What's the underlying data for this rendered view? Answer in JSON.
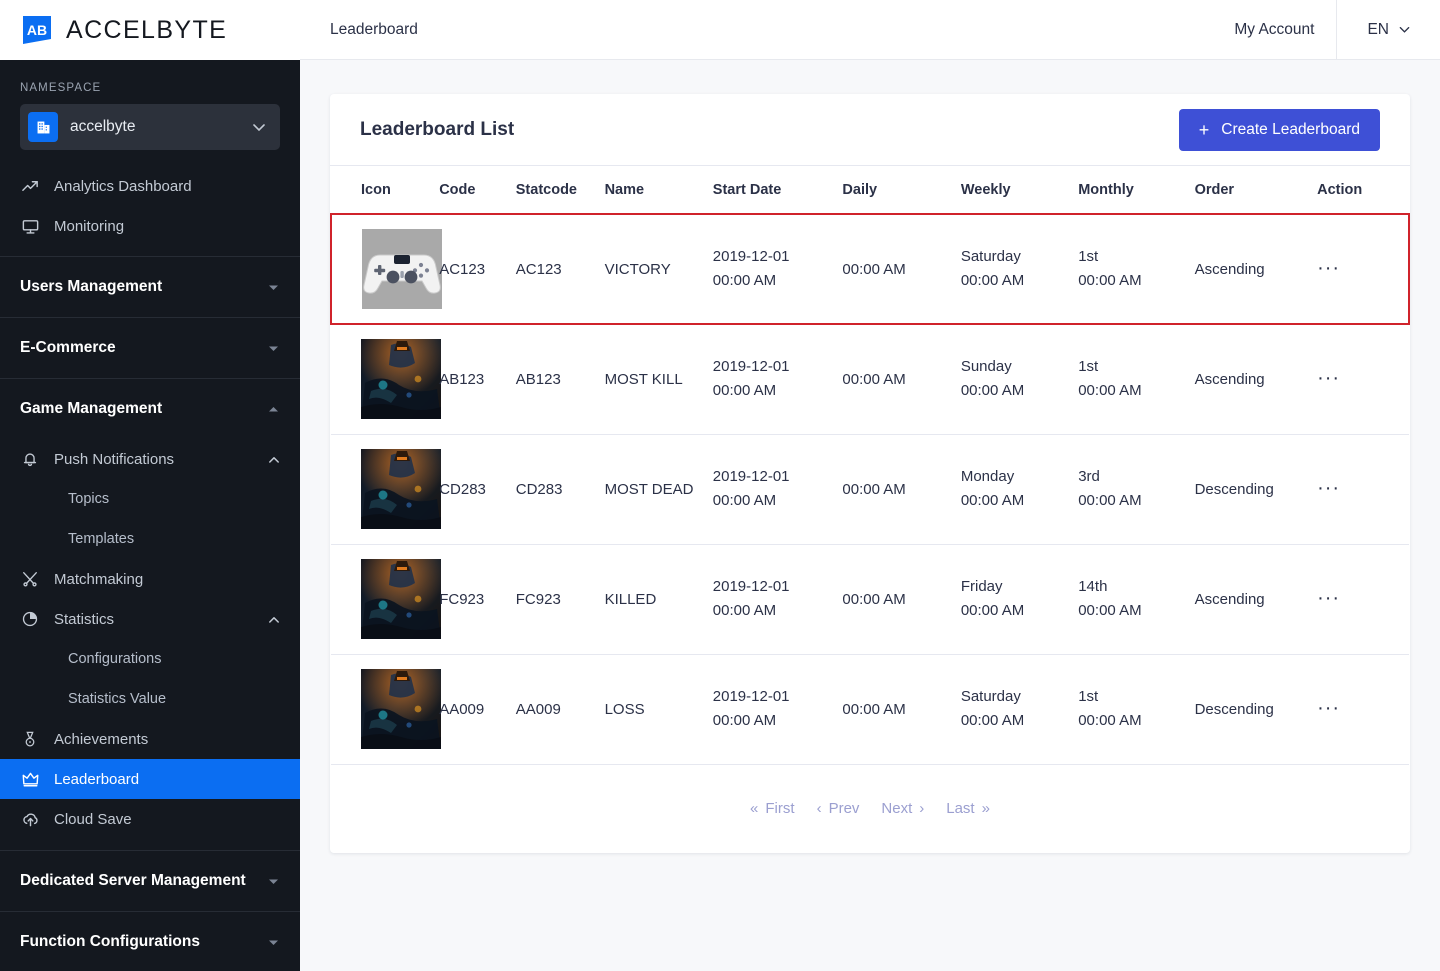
{
  "brand": {
    "name": "ACCELBYTE",
    "logo_icon": "accelbyte-logo-icon"
  },
  "sidebar": {
    "namespace_label": "NAMESPACE",
    "namespace_value": "accelbyte",
    "namespace_icon": "building-icon",
    "items": [
      {
        "label": "Analytics Dashboard",
        "icon": "trend-up-icon",
        "type": "item"
      },
      {
        "label": "Monitoring",
        "icon": "monitor-icon",
        "type": "item"
      },
      {
        "label": "Users Management",
        "icon": "",
        "type": "group",
        "caret": "down"
      },
      {
        "label": "E-Commerce",
        "icon": "",
        "type": "group",
        "caret": "down"
      },
      {
        "label": "Game Management",
        "icon": "",
        "type": "group",
        "caret": "up"
      },
      {
        "label": "Push Notifications",
        "icon": "bell-icon",
        "type": "item",
        "caret": "up"
      },
      {
        "label": "Topics",
        "icon": "",
        "type": "sub"
      },
      {
        "label": "Templates",
        "icon": "",
        "type": "sub"
      },
      {
        "label": "Matchmaking",
        "icon": "matchmaking-icon",
        "type": "item"
      },
      {
        "label": "Statistics",
        "icon": "pie-chart-icon",
        "type": "item",
        "caret": "up"
      },
      {
        "label": "Configurations",
        "icon": "",
        "type": "sub"
      },
      {
        "label": "Statistics Value",
        "icon": "",
        "type": "sub"
      },
      {
        "label": "Achievements",
        "icon": "medal-icon",
        "type": "item"
      },
      {
        "label": "Leaderboard",
        "icon": "crown-icon",
        "type": "item",
        "active": true
      },
      {
        "label": "Cloud Save",
        "icon": "cloud-upload-icon",
        "type": "item"
      },
      {
        "label": "Dedicated Server Management",
        "icon": "",
        "type": "group",
        "caret": "down"
      },
      {
        "label": "Function Configurations",
        "icon": "",
        "type": "group",
        "caret": "down"
      }
    ],
    "active_color": "#0B6EF2"
  },
  "topbar": {
    "breadcrumb": "Leaderboard",
    "my_account": "My Account",
    "language": "EN"
  },
  "card": {
    "title": "Leaderboard List",
    "create_button": "Create Leaderboard",
    "create_button_color": "#3E50D6",
    "columns": [
      "Icon",
      "Code",
      "Statcode",
      "Name",
      "Start Date",
      "Daily",
      "Weekly",
      "Monthly",
      "Order",
      "Action"
    ],
    "rows": [
      {
        "icon": "ps4-controller-thumbnail",
        "icon_kind": "controller",
        "code": "AC123",
        "statcode": "AC123",
        "name": "VICTORY",
        "start_date": "2019-12-01",
        "start_time": "00:00 AM",
        "daily": "00:00 AM",
        "weekly_day": "Saturday",
        "weekly_time": "00:00 AM",
        "monthly_day": "1st",
        "monthly_time": "00:00 AM",
        "order": "Ascending",
        "action": "···",
        "selected": true
      },
      {
        "icon": "game-artwork-thumbnail",
        "icon_kind": "artwork",
        "code": "AB123",
        "statcode": "AB123",
        "name": "MOST KILL",
        "start_date": "2019-12-01",
        "start_time": "00:00 AM",
        "daily": "00:00 AM",
        "weekly_day": "Sunday",
        "weekly_time": "00:00 AM",
        "monthly_day": "1st",
        "monthly_time": "00:00 AM",
        "order": "Ascending",
        "action": "···",
        "selected": false
      },
      {
        "icon": "game-artwork-thumbnail",
        "icon_kind": "artwork",
        "code": "CD283",
        "statcode": "CD283",
        "name": "MOST DEAD",
        "start_date": "2019-12-01",
        "start_time": "00:00 AM",
        "daily": "00:00 AM",
        "weekly_day": "Monday",
        "weekly_time": "00:00 AM",
        "monthly_day": "3rd",
        "monthly_time": "00:00 AM",
        "order": "Descending",
        "action": "···",
        "selected": false
      },
      {
        "icon": "game-artwork-thumbnail",
        "icon_kind": "artwork",
        "code": "FC923",
        "statcode": "FC923",
        "name": "KILLED",
        "start_date": "2019-12-01",
        "start_time": "00:00 AM",
        "daily": "00:00 AM",
        "weekly_day": "Friday",
        "weekly_time": "00:00 AM",
        "monthly_day": "14th",
        "monthly_time": "00:00 AM",
        "order": "Ascending",
        "action": "···",
        "selected": false
      },
      {
        "icon": "game-artwork-thumbnail",
        "icon_kind": "artwork",
        "code": "AA009",
        "statcode": "AA009",
        "name": "LOSS",
        "start_date": "2019-12-01",
        "start_time": "00:00 AM",
        "daily": "00:00 AM",
        "weekly_day": "Saturday",
        "weekly_time": "00:00 AM",
        "monthly_day": "1st",
        "monthly_time": "00:00 AM",
        "order": "Descending",
        "action": "···",
        "selected": false
      }
    ],
    "selected_row_border_color": "#D0232B"
  },
  "pagination": {
    "first": "First",
    "prev": "Prev",
    "next": "Next",
    "last": "Last",
    "first_glyph": "«",
    "prev_glyph": "‹",
    "next_glyph": "›",
    "last_glyph": "»"
  }
}
